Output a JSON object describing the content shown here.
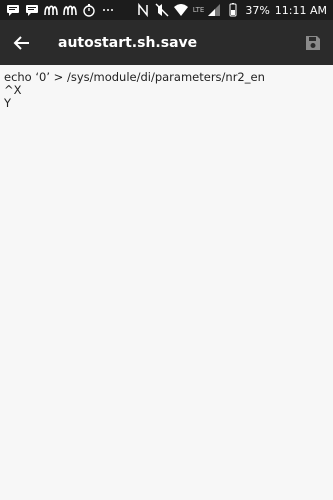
{
  "status_bar": {
    "network_type": "LTE",
    "battery": "37%",
    "time": "11:11 AM",
    "left_icons": [
      "message-icon",
      "message-icon",
      "mcdonalds-icon",
      "mcdonalds-icon",
      "stopwatch-icon",
      "more-icon"
    ],
    "right_icons": [
      "nfc-icon",
      "mute-icon",
      "wifi-icon",
      "signal-icon",
      "battery-icon"
    ]
  },
  "app_bar": {
    "title": "autostart.sh.save",
    "back_icon": "arrow-back-icon",
    "save_icon": "floppy-save-icon"
  },
  "editor": {
    "lines": [
      "echo ‘0’ > /sys/module/di/parameters/nr2_en",
      "^X",
      "Y"
    ]
  },
  "colors": {
    "status_bar_bg": "#1c1c1c",
    "app_bar_bg": "#2b2b2b",
    "editor_bg": "#f7f7f7",
    "text": "#222222"
  }
}
